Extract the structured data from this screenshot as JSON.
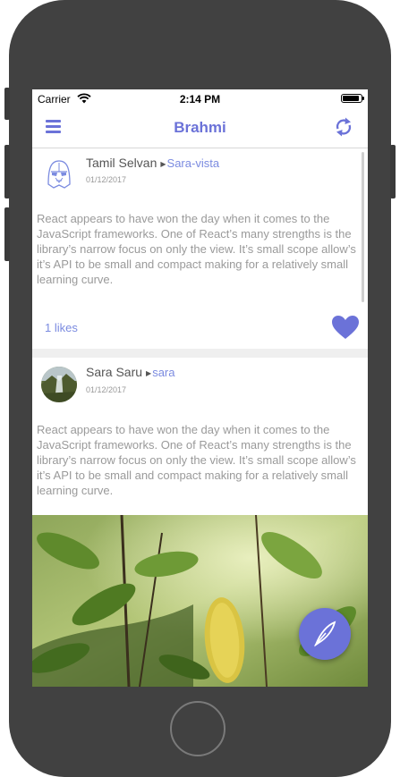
{
  "status_bar": {
    "carrier": "Carrier",
    "time": "2:14 PM",
    "battery_level": 0.9
  },
  "nav": {
    "title": "Brahmi",
    "left_icon": "hamburger-menu-icon",
    "right_icon": "refresh-icon"
  },
  "posts": [
    {
      "author": "Tamil Selvan",
      "tag": "Sara-vista",
      "date": "01/12/2017",
      "text": "React appears to have won the day when it comes to the JavaScript frameworks. One of React’s many strengths is the library’s narrow focus on only the view. It’s small scope allow’s it’s API to be small and compact making for a relatively small learning curve.",
      "likes": "1 likes",
      "avatar_icon": "darth-vader-avatar-icon",
      "liked": true
    },
    {
      "author": "Sara Saru",
      "tag": "sara",
      "date": "01/12/2017",
      "text": "React appears to have won the day when it comes to the JavaScript frameworks. One of React’s many strengths is the library’s narrow focus on only the view. It’s small scope allow’s it’s API to be small and compact making for a relatively small learning curve.",
      "avatar_icon": "waterfall-photo-avatar",
      "image": "leaves-photo"
    }
  ],
  "fab": {
    "icon": "feather-quill-icon"
  },
  "colors": {
    "accent": "#6b72d8",
    "text_muted": "#9a9a9a",
    "link": "#7b8be0"
  }
}
